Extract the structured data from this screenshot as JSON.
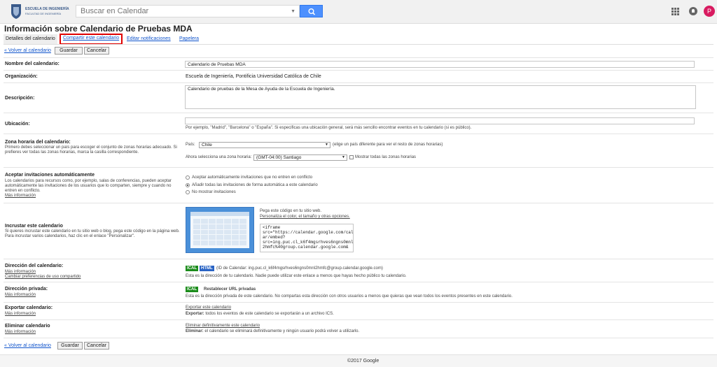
{
  "logo": {
    "line1": "ESCUELA DE INGENIERÍA",
    "line2": "FACULTAD DE INGENIERÍA"
  },
  "search": {
    "placeholder": "Buscar en Calendar"
  },
  "user": {
    "initial": "P",
    "color": "#d81b60"
  },
  "page": {
    "title": "Información sobre Calendario de Pruebas MDA"
  },
  "tabs": [
    {
      "label": "Detalles del calendario"
    },
    {
      "label": "Compartir este calendario"
    },
    {
      "label": "Editar notificaciones"
    },
    {
      "label": "Papelera"
    }
  ],
  "actions": {
    "back_top": "« Volver al calendario",
    "back_bottom": "« Volver al calendario",
    "save": "Guardar",
    "cancel": "Cancelar"
  },
  "fields": {
    "name": {
      "label": "Nombre del calendario:",
      "value": "Calendario de Pruebas MDA"
    },
    "org": {
      "label": "Organización:",
      "value": "Escuela de Ingeniería, Pontificia Universidad Católica de Chile"
    },
    "desc": {
      "label": "Descripción:",
      "value": "Calendario de pruebas de la Mesa de Ayuda de la Escuela de Ingeniería."
    },
    "location": {
      "label": "Ubicación:",
      "value": "",
      "hint": "Por ejemplo, \"Madrid\", \"Barcelona\" o \"España\". Si especificas una ubicación general, será más sencillo encontrar eventos en tu calendario (si es público)."
    },
    "timezone": {
      "label": "Zona horaria del calendario:",
      "sub": "Primero debes seleccionar un país para escoger el conjunto de zonas horarias adecuado. Si prefieres ver todas las zonas horarias, marca la casilla correspondiente.",
      "country_label": "País:",
      "country": "Chile",
      "country_hint": "(elige un país diferente para ver el resto de zonas horarias)",
      "zone_label": "Ahora selecciona una zona horaria:",
      "zone": "(GMT-04:00) Santiago",
      "show_all": "Mostrar todas las zonas horarias"
    },
    "invites": {
      "label": "Aceptar invitaciones automáticamente",
      "sub": "Los calendarios para recursos como, por ejemplo, salas de conferencias, pueden aceptar automáticamente las invitaciones de los usuarios que lo comparten, siempre y cuando no entren en conflicto.",
      "more": "Más información",
      "options": [
        "Aceptar automáticamente invitaciones que no entren en conflicto",
        "Añadir todas las invitaciones de forma automática a este calendario",
        "No mostrar invitaciones"
      ]
    },
    "embed": {
      "label": "Incrustar este calendario",
      "sub": "Si quieres incrustar este calendario en tu sitio web o blog, pega este código en la página web. Para incrustar varios calendarios, haz clic en el enlace \"Personalizar\".",
      "paste": "Pega este código en tu sitio web.",
      "customize": "Personaliza el color, el tamaño y otras opciones.",
      "code": "<iframe\nsrc=\"https://calendar.google.com/calend\nar/embed?\nsrc=ing.puc.cl_k6f4mgsrhves6ngns0mnl\n2hmfc%40group.calendar.google.com&"
    },
    "address": {
      "label": "Dirección del calendario:",
      "more": "Más información",
      "change": "Cambiar preferencias de uso compartido",
      "ical": "ICAL",
      "html": "HTML",
      "id": "(ID de Calendar: ing.puc.cl_k6f4mgsrhves6ngns0mnl2hmfc@group.calendar.google.com)",
      "desc": "Esta es la dirección de tu calendario. Nadie puede utilizar este enlace a menos que hayas hecho público tu calendario."
    },
    "private": {
      "label": "Dirección privada:",
      "more": "Más información",
      "ical": "ICAL",
      "reset": "Restablecer URL privadas",
      "desc": "Esta es la dirección privada de este calendario. No compartas esta dirección con otros usuarios a menos que quieras que vean todos los eventos presentes en este calendario."
    },
    "export": {
      "label": "Exportar calendario:",
      "more": "Más información",
      "link": "Exportar este calendario",
      "desc_bold": "Exportar:",
      "desc": " todos los eventos de este calendario se exportarán a un archivo ICS."
    },
    "delete": {
      "label": "Eliminar calendario",
      "more": "Más información",
      "link": "Eliminar definitivamente este calendario",
      "desc_bold": "Eliminar:",
      "desc": " el calendario se eliminará definitivamente y ningún usuario podrá volver a utilizarlo."
    }
  },
  "footer": {
    "text": "©2017 Google"
  }
}
